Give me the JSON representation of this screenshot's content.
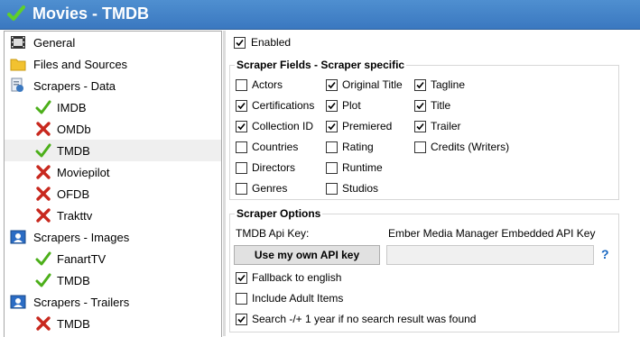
{
  "window": {
    "title": "Movies - TMDB"
  },
  "sidebar": {
    "items": [
      {
        "label": "General",
        "icon": "film-icon",
        "level": 0
      },
      {
        "label": "Files and Sources",
        "icon": "folder-icon",
        "level": 0
      },
      {
        "label": "Scrapers - Data",
        "icon": "data-scraper-icon",
        "level": 0
      },
      {
        "label": "IMDB",
        "icon": "check-icon",
        "level": 1
      },
      {
        "label": "OMDb",
        "icon": "x-icon",
        "level": 1
      },
      {
        "label": "TMDB",
        "icon": "check-icon",
        "level": 1,
        "selected": true
      },
      {
        "label": "Moviepilot",
        "icon": "x-icon",
        "level": 1
      },
      {
        "label": "OFDB",
        "icon": "x-icon",
        "level": 1
      },
      {
        "label": "Trakttv",
        "icon": "x-icon",
        "level": 1
      },
      {
        "label": "Scrapers - Images",
        "icon": "image-scraper-icon",
        "level": 0
      },
      {
        "label": "FanartTV",
        "icon": "check-icon",
        "level": 1
      },
      {
        "label": "TMDB",
        "icon": "check-icon",
        "level": 1
      },
      {
        "label": "Scrapers - Trailers",
        "icon": "trailer-scraper-icon",
        "level": 0
      },
      {
        "label": "TMDB",
        "icon": "x-icon",
        "level": 1
      }
    ]
  },
  "enabled": {
    "label": "Enabled",
    "checked": true
  },
  "scraper_fields": {
    "title": "Scraper Fields - Scraper specific",
    "col1": [
      {
        "label": "Actors",
        "checked": false
      },
      {
        "label": "Certifications",
        "checked": true
      },
      {
        "label": "Collection ID",
        "checked": true
      },
      {
        "label": "Countries",
        "checked": false
      },
      {
        "label": "Directors",
        "checked": false
      },
      {
        "label": "Genres",
        "checked": false
      }
    ],
    "col2": [
      {
        "label": "Original Title",
        "checked": true
      },
      {
        "label": "Plot",
        "checked": true
      },
      {
        "label": "Premiered",
        "checked": true
      },
      {
        "label": "Rating",
        "checked": false
      },
      {
        "label": "Runtime",
        "checked": false
      },
      {
        "label": "Studios",
        "checked": false
      }
    ],
    "col3": [
      {
        "label": "Tagline",
        "checked": true
      },
      {
        "label": "Title",
        "checked": true
      },
      {
        "label": "Trailer",
        "checked": true
      },
      {
        "label": "Credits (Writers)",
        "checked": false
      }
    ]
  },
  "scraper_options": {
    "title": "Scraper Options",
    "api_key_label": "TMDB Api Key:",
    "api_key_value": "Ember Media Manager Embedded API Key",
    "own_key_button": "Use my own API key",
    "api_key_input": "",
    "help_symbol": "?",
    "options": [
      {
        "label": "Fallback to english",
        "checked": true
      },
      {
        "label": "Include Adult Items",
        "checked": false
      },
      {
        "label": "Search -/+ 1 year if no search result was found",
        "checked": true
      }
    ]
  },
  "colors": {
    "titlebar": "#3a78c0",
    "check": "#4caf1a",
    "cross": "#c8281e",
    "help": "#1565c0"
  }
}
